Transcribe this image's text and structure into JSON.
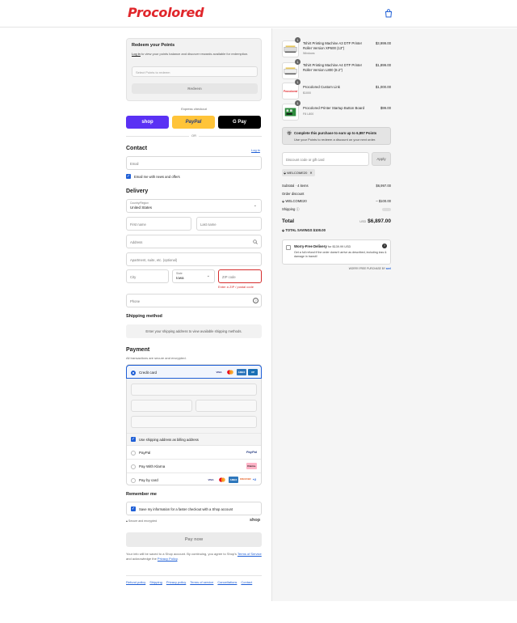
{
  "brand": {
    "logo_text": "Procolored",
    "accent": "#e0262b",
    "link_color": "#1f5fd6"
  },
  "header": {
    "cart_icon": "shopping-bag-icon"
  },
  "redeem": {
    "title": "Redeem your Points",
    "login_link": "Log in",
    "desc": " to view your points balance and discover rewards available for redemption.",
    "select_placeholder": "Select Points to redeem",
    "button": "Redeem"
  },
  "express": {
    "label": "Express checkout",
    "shop": "shop",
    "paypal": "PayPal",
    "gpay": "G Pay",
    "or": "OR"
  },
  "contact": {
    "title": "Contact",
    "login": "Log in",
    "email_placeholder": "Email",
    "news_label": "Email me with news and offers"
  },
  "delivery": {
    "title": "Delivery",
    "country_label": "Country/Region",
    "country_value": "United States",
    "first_name": "First name",
    "last_name": "Last name",
    "address": "Address",
    "apartment": "Apartment, suite, etc. (optional)",
    "city": "City",
    "state_label": "State",
    "state_value": "Iowa",
    "zip": "ZIP code",
    "zip_error": "Enter a ZIP / postal code",
    "phone": "Phone"
  },
  "shipping_method": {
    "title": "Shipping method",
    "note": "Enter your shipping address to view available shipping methods."
  },
  "payment": {
    "title": "Payment",
    "subtitle": "All transactions are secure and encrypted.",
    "credit_card": "Credit card",
    "billing_label": "Use shipping address as billing address",
    "paypal": "PayPal",
    "klarna": "Pay With Klarna",
    "card": "Pay by card",
    "more_cards": "+2"
  },
  "remember": {
    "title": "Remember me",
    "save_label": "Save my information for a faster checkout with a Shop account",
    "secure": "Secure and encrypted",
    "shop": "shop"
  },
  "pay_now": "Pay now",
  "terms": {
    "text1": "Your info will be saved to a Shop account. By continuing, you agree to Shop's",
    "tos": "Terms of Service",
    "text2": " and acknowledge the ",
    "privacy": "Privacy Policy",
    "text3": "."
  },
  "footer": [
    "Refund policy",
    "Shipping",
    "Privacy policy",
    "Terms of service",
    "Cancellations",
    "Contact"
  ],
  "cart": {
    "items": [
      {
        "qty": "1",
        "name": "Tshirt Printing Machine A3 DTF Printer Roller Version XP600 (13\")",
        "variant": "Windows",
        "price": "$3,999.00"
      },
      {
        "qty": "1",
        "name": "Tshirt Printing Machine A4 DTF Printer Roller Version L800 (8.2\")",
        "variant": "",
        "price": "$1,899.00"
      },
      {
        "qty": "1",
        "name": "Procolored Custom Link",
        "variant": "$1000",
        "price": "$1,000.00"
      },
      {
        "qty": "1",
        "name": "Procolored Printer Startup Button Board",
        "variant": "F8 L800",
        "price": "$99.00"
      }
    ],
    "points_title": "Complete this purchase to earn up to 6,897 Points",
    "points_sub": "Use your Points to redeem a discount on your next order.",
    "discount_placeholder": "Discount code or gift card",
    "apply": "Apply",
    "code": "WELCOME20",
    "subtotal_label": "Subtotal · 4 items",
    "subtotal": "$6,997.00",
    "order_discount_label": "Order discount",
    "discount_code": "WELCOME20",
    "discount_value": "– $100.00",
    "shipping_label": "Shipping",
    "total_label": "Total",
    "currency": "USD",
    "total": "$6,897.00",
    "savings_label": "TOTAL SAVINGS",
    "savings": "$100.00",
    "worry_title": "Worry-Free Delivery",
    "worry_price": "for $139.99 USD",
    "worry_desc": "Get a full refund if the order doesn't arrive as described, including loss & damage in transit!",
    "worry_footer_a": "WORRY-FREE PURCHASE BY ",
    "worry_footer_b": "seel"
  }
}
